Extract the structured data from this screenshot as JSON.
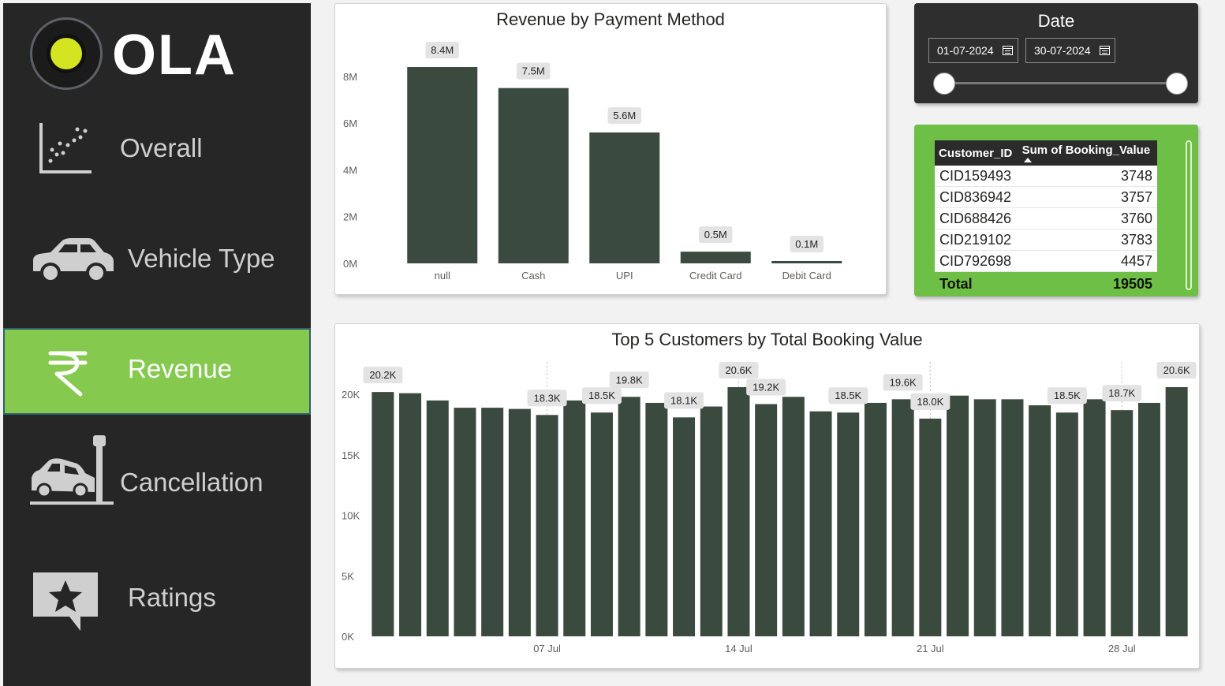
{
  "sidebar": {
    "logo_text": "OLA",
    "items": [
      {
        "label": "Overall",
        "icon": "scatter-chart-icon"
      },
      {
        "label": "Vehicle Type",
        "icon": "car-icon"
      },
      {
        "label": "Revenue",
        "icon": "rupee-icon",
        "active": true
      },
      {
        "label": "Cancellation",
        "icon": "car-crash-icon"
      },
      {
        "label": "Ratings",
        "icon": "star-speech-bubble-icon"
      }
    ]
  },
  "colors": {
    "sidebar_bg": "#262626",
    "active_green": "#86c94f",
    "bar": "#3b4a3f",
    "table_card": "#6dbf45",
    "date_card": "#2e2e2e"
  },
  "date_filter": {
    "title": "Date",
    "start": "01-07-2024",
    "end": "30-07-2024",
    "range_selected": [
      0,
      1
    ]
  },
  "customer_table": {
    "columns": [
      "Customer_ID",
      "Sum of Booking_Value"
    ],
    "rows": [
      {
        "id": "CID159493",
        "value": "3748"
      },
      {
        "id": "CID836942",
        "value": "3757"
      },
      {
        "id": "CID688426",
        "value": "3760"
      },
      {
        "id": "CID219102",
        "value": "3783"
      },
      {
        "id": "CID792698",
        "value": "4457"
      }
    ],
    "total_label": "Total",
    "total_value": "19505"
  },
  "chart_data": [
    {
      "type": "bar",
      "title": "Revenue by Payment Method",
      "categories": [
        "null",
        "Cash",
        "UPI",
        "Credit Card",
        "Debit Card"
      ],
      "values": [
        8.4,
        7.5,
        5.6,
        0.5,
        0.1
      ],
      "data_labels": [
        "8.4M",
        "7.5M",
        "5.6M",
        "0.5M",
        "0.1M"
      ],
      "y_ticks": [
        "0M",
        "2M",
        "4M",
        "6M",
        "8M"
      ],
      "unit": "M",
      "ylim": [
        0,
        8.4
      ]
    },
    {
      "type": "bar",
      "title": "Top 5 Customers by Total Booking Value",
      "x_ticks": [
        {
          "label": "07 Jul",
          "day": 7
        },
        {
          "label": "14 Jul",
          "day": 14
        },
        {
          "label": "21 Jul",
          "day": 21
        },
        {
          "label": "28 Jul",
          "day": 28
        }
      ],
      "x": [
        1,
        2,
        3,
        4,
        5,
        6,
        7,
        8,
        9,
        10,
        11,
        12,
        13,
        14,
        15,
        16,
        17,
        18,
        19,
        20,
        21,
        22,
        23,
        24,
        25,
        26,
        27,
        28,
        29,
        30
      ],
      "values": [
        20.2,
        20.1,
        19.5,
        18.9,
        18.9,
        18.8,
        18.3,
        19.5,
        18.5,
        19.8,
        19.3,
        18.1,
        19.0,
        20.6,
        19.2,
        19.8,
        18.6,
        18.5,
        19.3,
        19.6,
        18.0,
        19.9,
        19.6,
        19.6,
        19.1,
        18.5,
        19.6,
        18.7,
        19.3,
        20.6
      ],
      "data_labels": {
        "1": "20.2K",
        "7": "18.3K",
        "9": "18.5K",
        "10": "19.8K",
        "12": "18.1K",
        "14": "20.6K",
        "15": "19.2K",
        "18": "18.5K",
        "20": "19.6K",
        "21": "18.0K",
        "26": "18.5K",
        "28": "18.7K",
        "30": "20.6K"
      },
      "y_ticks": [
        "0K",
        "5K",
        "10K",
        "15K",
        "20K"
      ],
      "unit": "K",
      "ylim": [
        0,
        20.6
      ]
    }
  ]
}
